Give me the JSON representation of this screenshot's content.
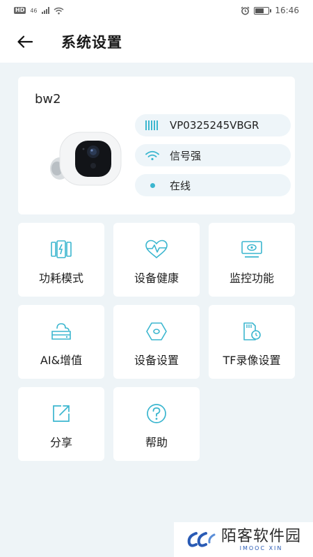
{
  "statusbar": {
    "network": "46",
    "time": "16:46",
    "battery_level": 0.6
  },
  "header": {
    "title": "系统设置"
  },
  "device": {
    "name": "bw2",
    "serial": "VP0325245VBGR",
    "signal": "信号强",
    "status": "在线"
  },
  "tiles": [
    {
      "label": "功耗模式",
      "icon": "power-mode-icon"
    },
    {
      "label": "设备健康",
      "icon": "heart-pulse-icon"
    },
    {
      "label": "监控功能",
      "icon": "monitor-icon"
    },
    {
      "label": "AI&增值",
      "icon": "cloud-storage-icon"
    },
    {
      "label": "设备设置",
      "icon": "hexagon-settings-icon"
    },
    {
      "label": "TF录像设置",
      "icon": "sd-card-icon"
    },
    {
      "label": "分享",
      "icon": "share-icon"
    },
    {
      "label": "帮助",
      "icon": "help-icon"
    }
  ],
  "watermark": {
    "main": "陌客软件园",
    "sub": "IMOOC XIN"
  },
  "colors": {
    "accent": "#3bb6cf",
    "background": "#eef4f7",
    "pill": "#eef5f9"
  }
}
